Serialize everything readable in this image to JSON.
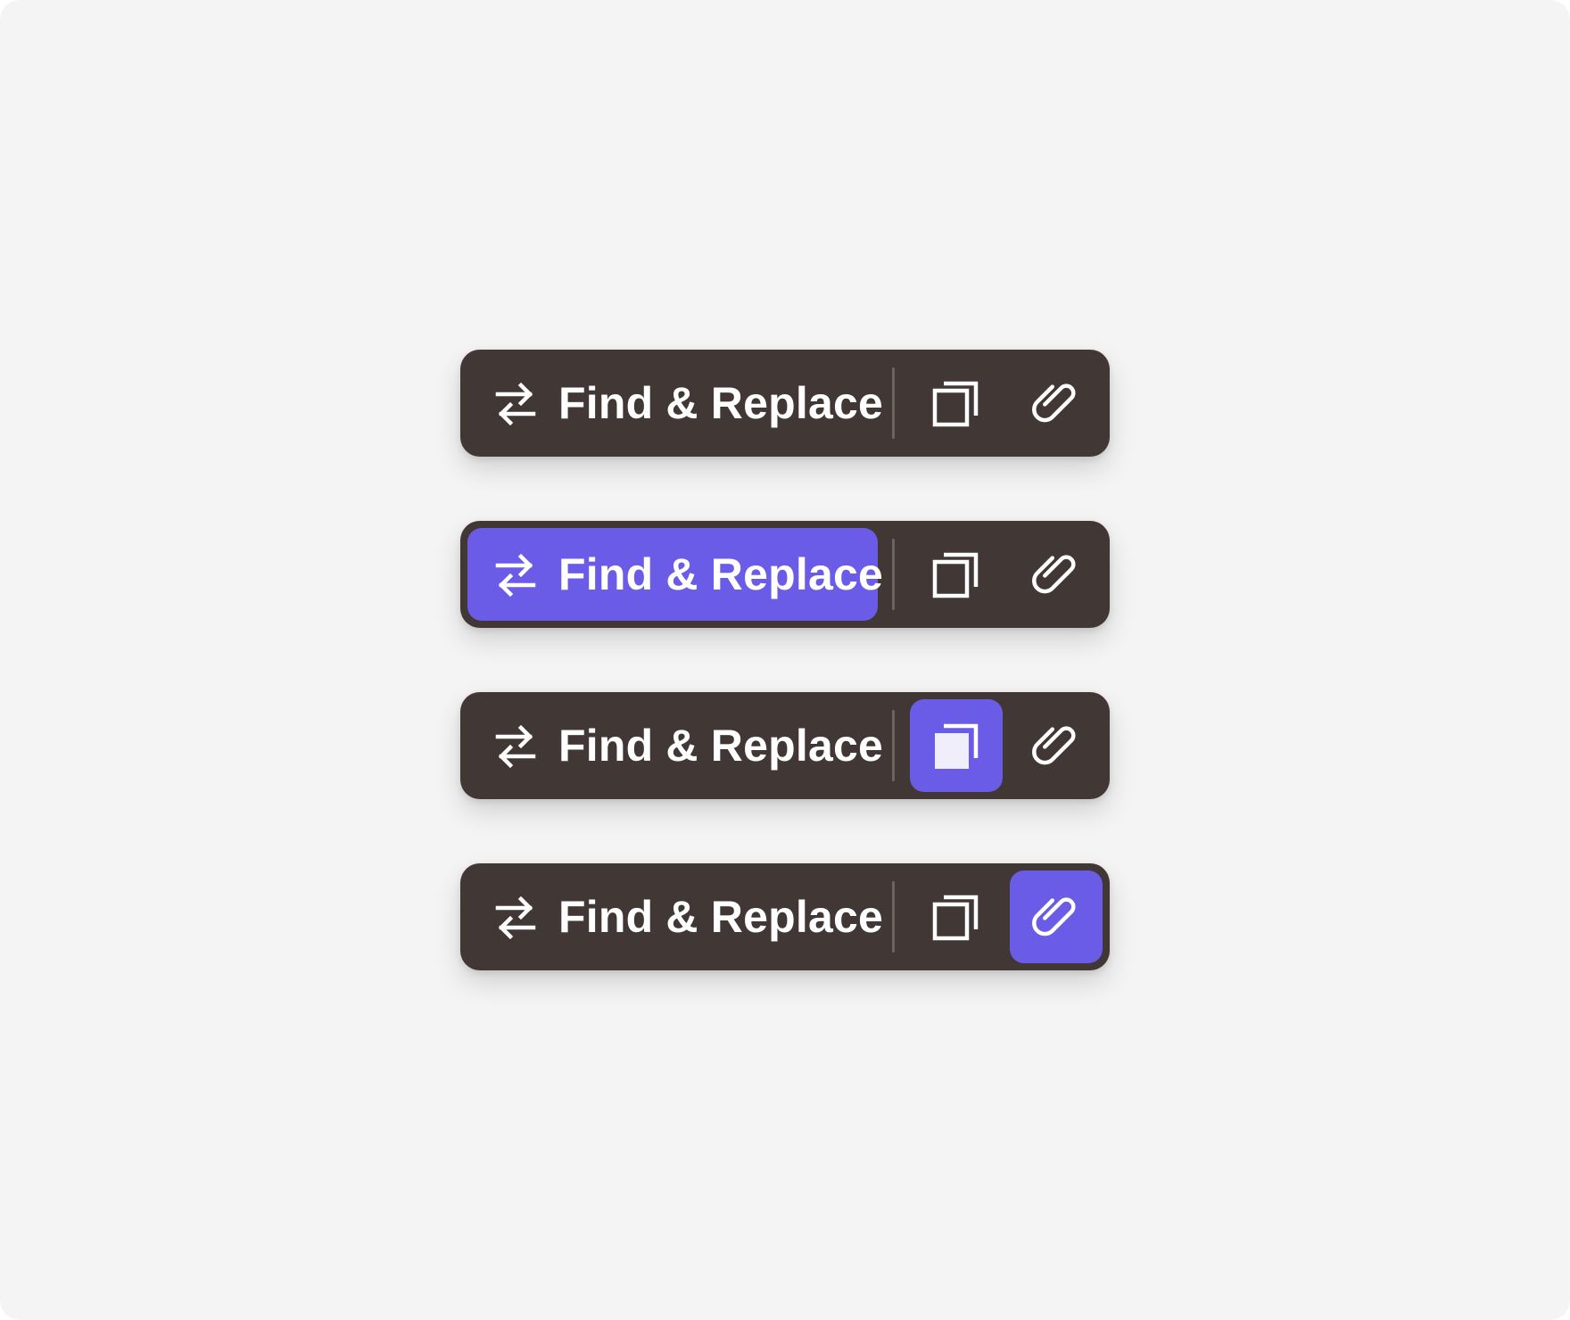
{
  "toolbars": [
    {
      "active": "none",
      "find_replace": {
        "label": "Find & Replace",
        "icon": "swap-arrows-icon"
      },
      "copy_icon": "copy-layers-icon",
      "attach_icon": "paperclip-icon"
    },
    {
      "active": "find_replace",
      "find_replace": {
        "label": "Find & Replace",
        "icon": "swap-arrows-icon"
      },
      "copy_icon": "copy-layers-icon",
      "attach_icon": "paperclip-icon"
    },
    {
      "active": "copy",
      "find_replace": {
        "label": "Find & Replace",
        "icon": "swap-arrows-icon"
      },
      "copy_icon": "copy-layers-icon",
      "attach_icon": "paperclip-icon"
    },
    {
      "active": "attach",
      "find_replace": {
        "label": "Find & Replace",
        "icon": "swap-arrows-icon"
      },
      "copy_icon": "copy-layers-icon",
      "attach_icon": "paperclip-icon"
    }
  ],
  "colors": {
    "toolbar_bg": "#413735",
    "accent": "#6b5ce7",
    "page_bg": "#f4f4f4",
    "icon": "#ffffff",
    "divider": "#6e6360"
  }
}
